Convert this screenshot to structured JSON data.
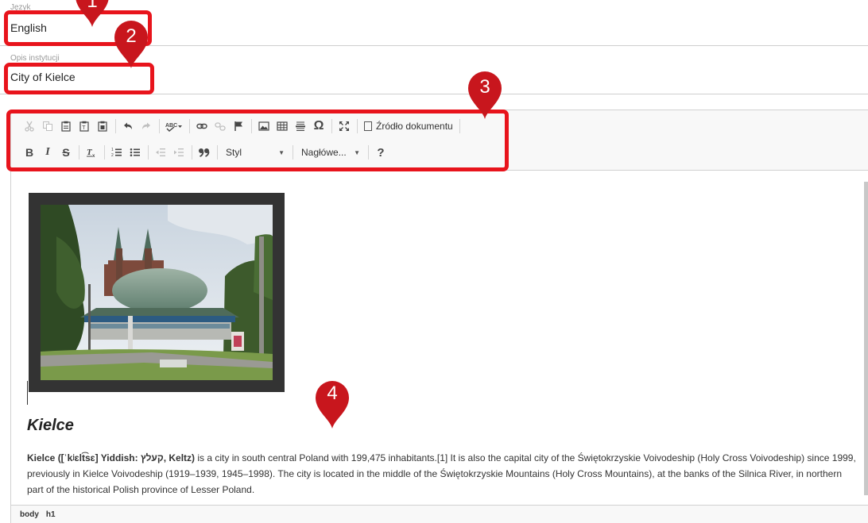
{
  "fields": {
    "language": {
      "label": "Język",
      "value": "English"
    },
    "institution": {
      "label": "Opis instytucji",
      "value": "City of Kielce"
    }
  },
  "toolbar": {
    "row1": [
      "cut-icon",
      "copy-icon",
      "paste-icon",
      "paste-text-icon",
      "paste-word-icon",
      "undo-icon",
      "redo-icon",
      "spellcheck-icon",
      "link-icon",
      "unlink-icon",
      "anchor-icon",
      "image-icon",
      "table-icon",
      "horizontal-line-icon",
      "special-char-icon",
      "maximize-icon"
    ],
    "source_label": "Źródło dokumentu",
    "bold": "B",
    "italic": "I",
    "strike": "S",
    "remove_format": "Tx",
    "blockquote": "99",
    "style_combo": "Styl",
    "heading_combo": "Nagłówe...",
    "about": "?"
  },
  "article": {
    "title": "Kielce",
    "body_intro_bold": "Kielce ([ˈkʲɛlt͡sɛ] Yiddish: קעלץ, Keltz)",
    "body_rest": " is a city in south central Poland with 199,475 inhabitants.[1] It is also the capital city of the Świętokrzyskie Voivodeship (Holy Cross Voivodeship) since 1999, previously in Kielce Voivodeship (1919–1939, 1945–1998). The city is located in the middle of the Świętokrzyskie Mountains (Holy Cross Mountains), at the banks of the Silnica River, in northern part of the historical Polish province of Lesser Poland."
  },
  "statusbar": {
    "path": [
      "body",
      "h1"
    ]
  },
  "markers": [
    {
      "label": "1"
    },
    {
      "label": "2"
    },
    {
      "label": "3"
    },
    {
      "label": "4"
    }
  ],
  "colors": {
    "highlight": "#e8141c",
    "marker": "#c8161d",
    "toolbar_bg": "#f8f8f8"
  }
}
